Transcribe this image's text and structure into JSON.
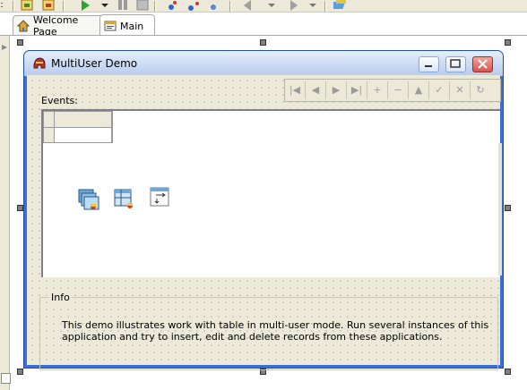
{
  "tabs": [
    {
      "label": "Welcome Page",
      "icon": "home-icon",
      "active": false
    },
    {
      "label": "Main",
      "icon": "form-icon",
      "active": true
    }
  ],
  "form": {
    "title": "MultiUser Demo",
    "events_label": "Events:",
    "info_title": "Info",
    "info_text": "This demo illustrates work with table in multi-user mode. Run several instances of this application and try to insert, edit and delete records from these applications."
  },
  "navigator": {
    "buttons": [
      "first",
      "prior",
      "next",
      "last",
      "insert",
      "delete",
      "edit",
      "post",
      "cancel",
      "refresh"
    ]
  },
  "components": [
    "database-component-icon",
    "table-component-icon",
    "datasource-component-icon"
  ],
  "colors": {
    "titlebar": "#c8d9f3",
    "form_border": "#3a6fd6",
    "form_bg": "#ece9d8",
    "close_button": "#d9534f"
  }
}
